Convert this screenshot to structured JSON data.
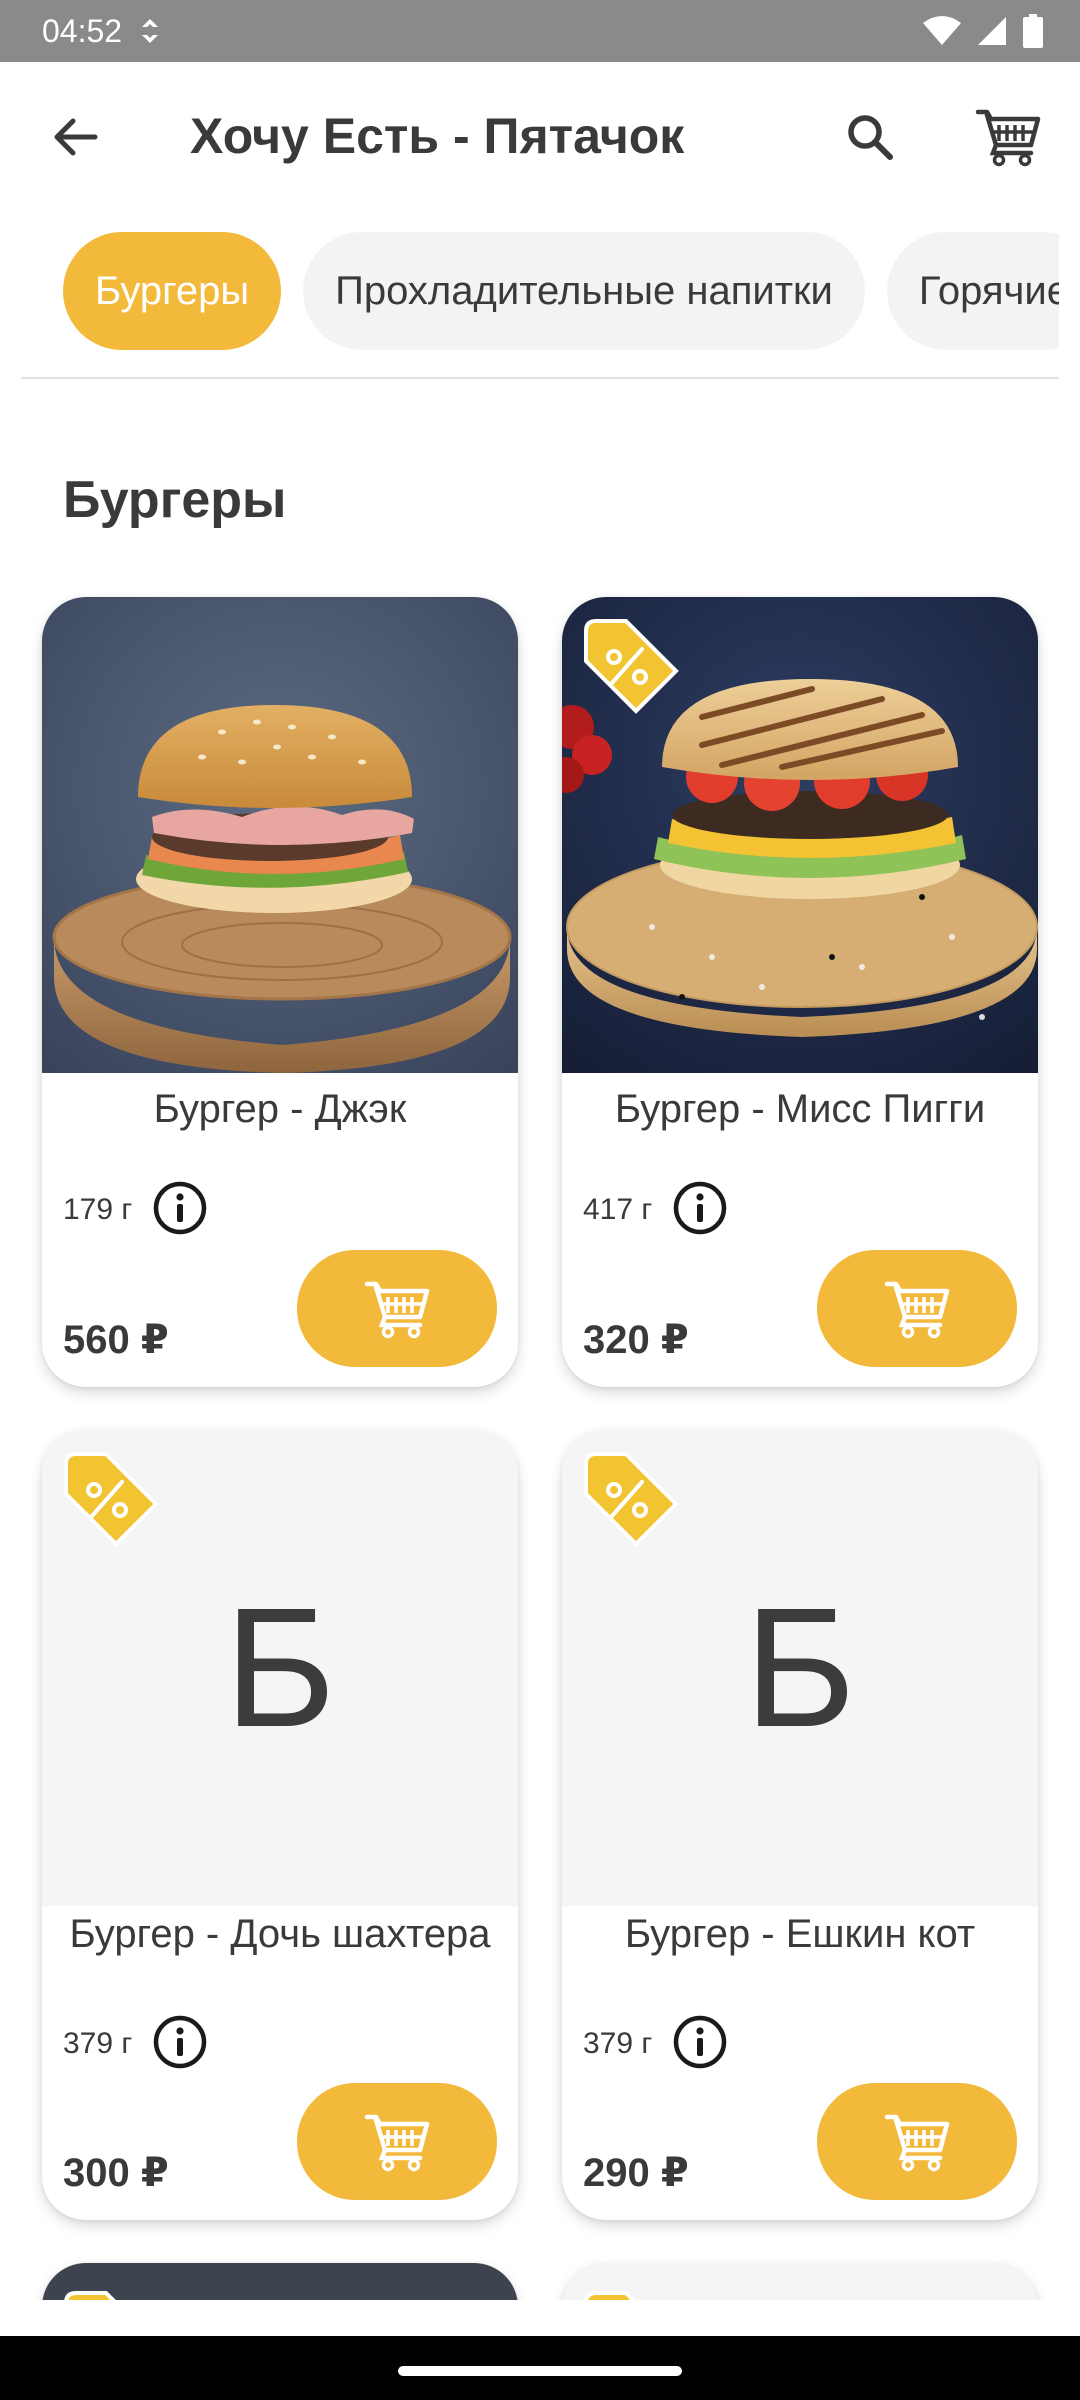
{
  "status": {
    "time": "04:52"
  },
  "appbar": {
    "title": "Хочу Есть - Пятачок"
  },
  "categories": [
    {
      "label": "Бургеры",
      "active": true
    },
    {
      "label": "Прохладительные напитки",
      "active": false
    },
    {
      "label": "Горячие",
      "active": false
    }
  ],
  "section": {
    "title": "Бургеры"
  },
  "products": [
    {
      "name": "Бургер - Джэк",
      "weight": "179 г",
      "price": "560 ₽",
      "discount": false,
      "image": "photo",
      "placeholder": ""
    },
    {
      "name": "Бургер - Мисс Пигги",
      "weight": "417 г",
      "price": "320 ₽",
      "discount": true,
      "image": "photo",
      "placeholder": ""
    },
    {
      "name": "Бургер - Дочь шахтера",
      "weight": "379 г",
      "price": "300 ₽",
      "discount": true,
      "image": "placeholder",
      "placeholder": "Б"
    },
    {
      "name": "Бургер - Ешкин кот",
      "weight": "379 г",
      "price": "290 ₽",
      "discount": true,
      "image": "placeholder",
      "placeholder": "Б"
    }
  ],
  "colors": {
    "accent": "#f2b93b",
    "statusbar": "#8a8a8c",
    "text": "#3a3a3a"
  },
  "icons": [
    "back-arrow-icon",
    "search-icon",
    "cart-icon",
    "info-icon",
    "discount-tag-icon",
    "wifi-icon",
    "signal-icon",
    "battery-icon",
    "data-saver-icon"
  ]
}
